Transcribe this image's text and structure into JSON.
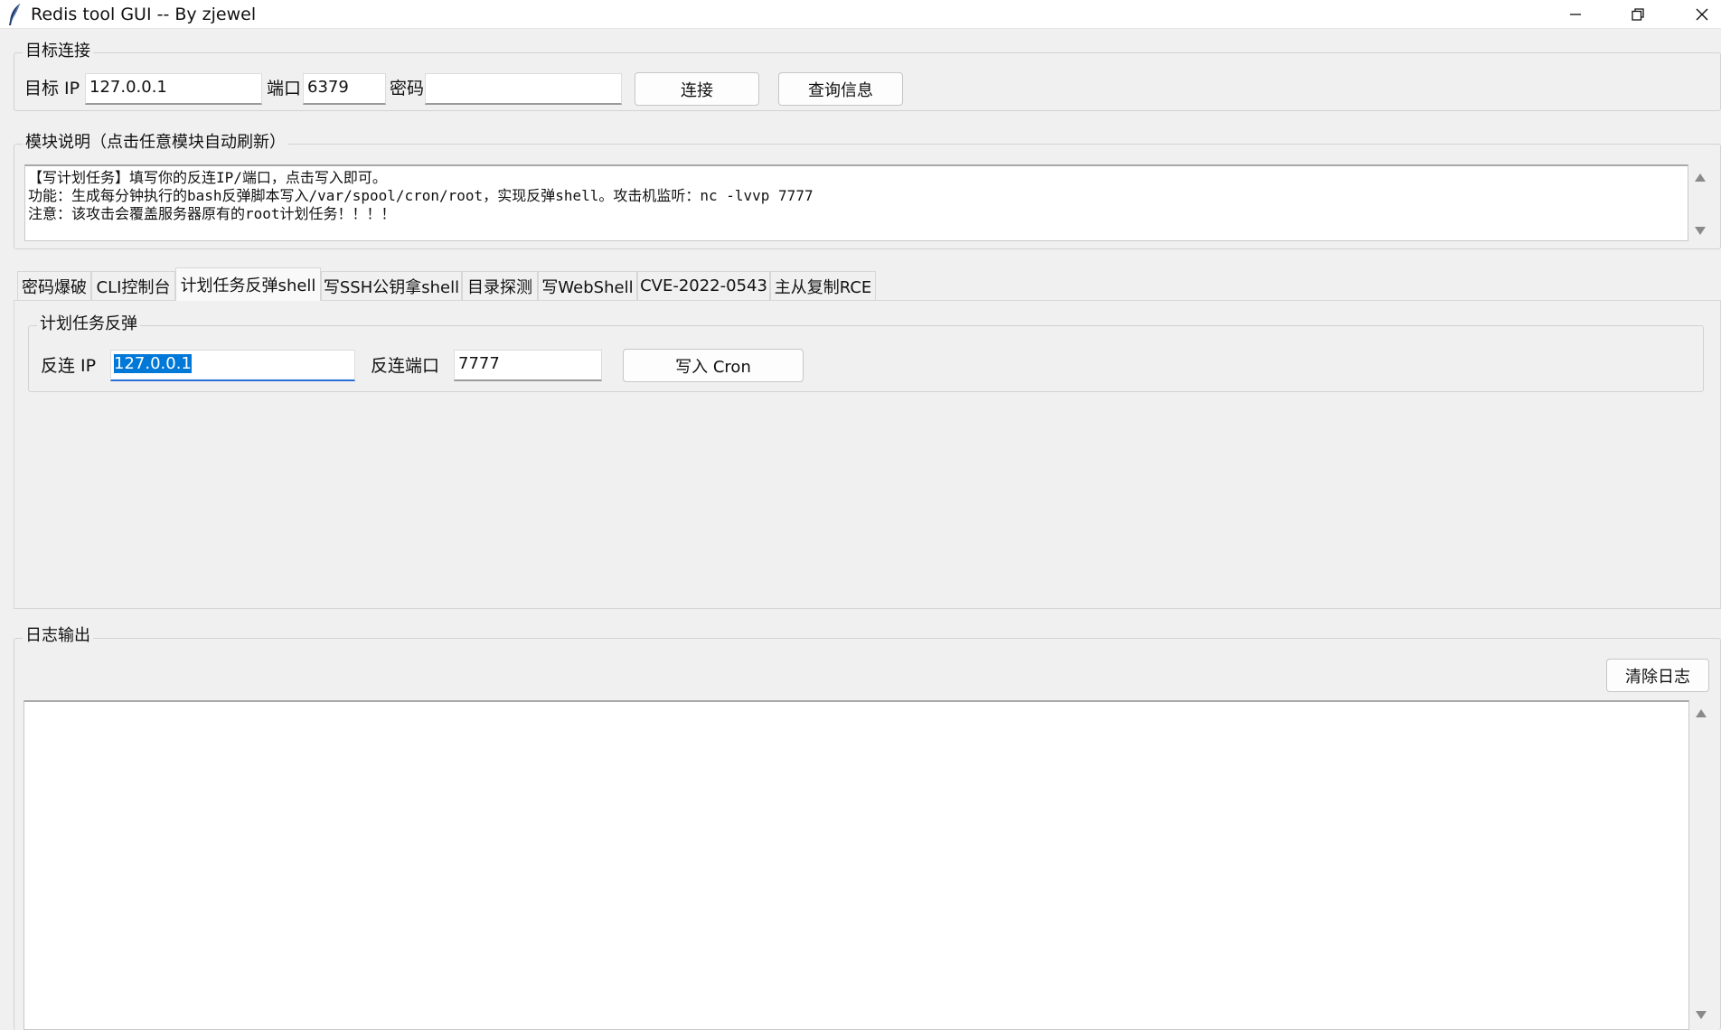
{
  "window": {
    "title": "Redis tool GUI -- By zjewel",
    "icon": "feather-icon"
  },
  "connection": {
    "legend": "目标连接",
    "ip_label": "目标 IP",
    "ip_value": "127.0.0.1",
    "port_label": "端口",
    "port_value": "6379",
    "password_label": "密码",
    "password_value": "",
    "connect_label": "连接",
    "info_label": "查询信息"
  },
  "module_desc": {
    "legend": "模块说明（点击任意模块自动刷新）",
    "text": "【写计划任务】填写你的反连IP/端口，点击写入即可。\n功能：生成每分钟执行的bash反弹脚本写入/var/spool/cron/root，实现反弹shell。攻击机监听：nc -lvvp 7777\n注意：该攻击会覆盖服务器原有的root计划任务！！！！"
  },
  "tabs": [
    {
      "label": "密码爆破",
      "active": false
    },
    {
      "label": "CLI控制台",
      "active": false
    },
    {
      "label": "计划任务反弹shell",
      "active": true
    },
    {
      "label": "写SSH公钥拿shell",
      "active": false
    },
    {
      "label": "目录探测",
      "active": false
    },
    {
      "label": "写WebShell",
      "active": false
    },
    {
      "label": "CVE-2022-0543",
      "active": false
    },
    {
      "label": "主从复制RCE",
      "active": false
    }
  ],
  "cron": {
    "legend": "计划任务反弹",
    "ip_label": "反连 IP",
    "ip_value": "127.0.0.1",
    "port_label": "反连端口",
    "port_value": "7777",
    "write_label": "写入 Cron"
  },
  "log": {
    "legend": "日志输出",
    "clear_label": "清除日志",
    "content": ""
  },
  "colors": {
    "background": "#f0f0f0",
    "selection": "#0078d7",
    "focus_border": "#2a6fd6"
  }
}
